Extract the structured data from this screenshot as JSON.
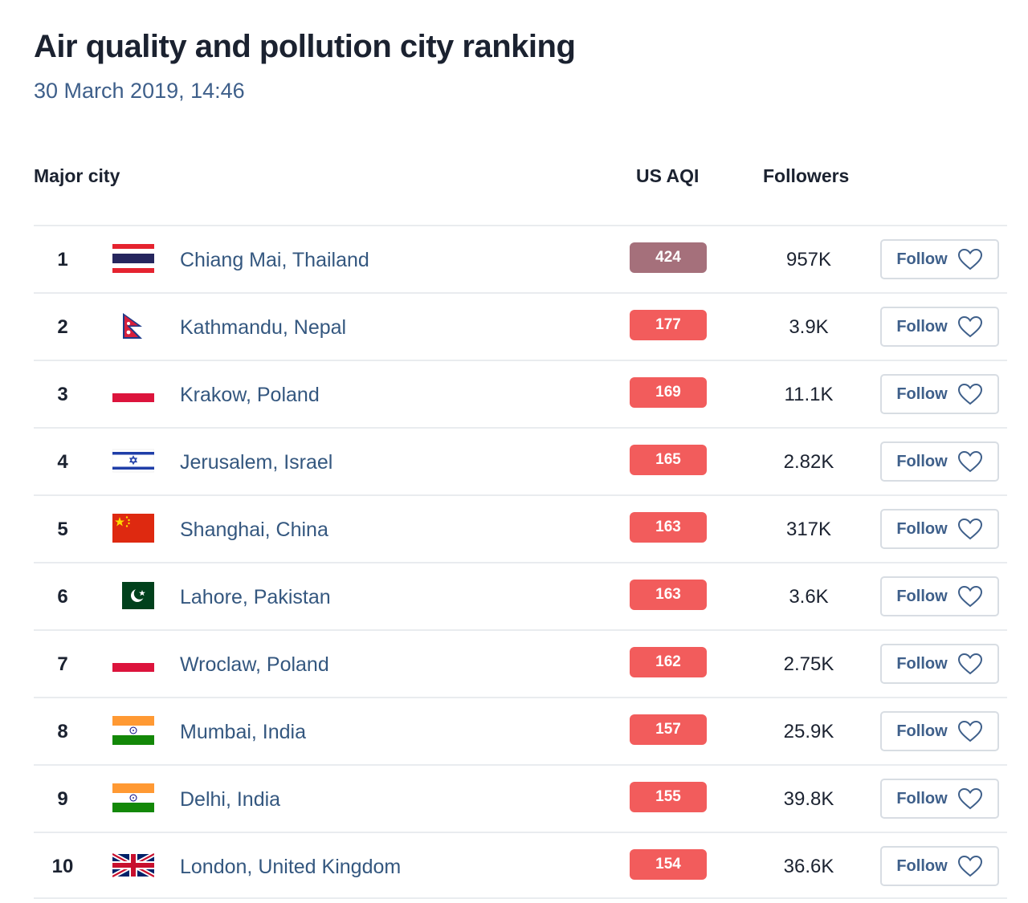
{
  "page": {
    "title": "Air quality and pollution city ranking",
    "timestamp": "30 March 2019, 14:46"
  },
  "columns": {
    "city": "Major city",
    "aqi": "US AQI",
    "followers": "Followers"
  },
  "colors": {
    "hazardous": "#a5707b",
    "unhealthy": "#f25c5c"
  },
  "rows": [
    {
      "rank": "1",
      "flag": "flag-thailand-icon",
      "city": "Chiang Mai, Thailand",
      "aqi": "424",
      "aqi_color": "#a5707b",
      "followers": "957K",
      "follow_label": "Follow"
    },
    {
      "rank": "2",
      "flag": "flag-nepal-icon",
      "city": "Kathmandu, Nepal",
      "aqi": "177",
      "aqi_color": "#f25c5c",
      "followers": "3.9K",
      "follow_label": "Follow"
    },
    {
      "rank": "3",
      "flag": "flag-poland-icon",
      "city": "Krakow, Poland",
      "aqi": "169",
      "aqi_color": "#f25c5c",
      "followers": "11.1K",
      "follow_label": "Follow"
    },
    {
      "rank": "4",
      "flag": "flag-israel-icon",
      "city": "Jerusalem, Israel",
      "aqi": "165",
      "aqi_color": "#f25c5c",
      "followers": "2.82K",
      "follow_label": "Follow"
    },
    {
      "rank": "5",
      "flag": "flag-china-icon",
      "city": "Shanghai, China",
      "aqi": "163",
      "aqi_color": "#f25c5c",
      "followers": "317K",
      "follow_label": "Follow"
    },
    {
      "rank": "6",
      "flag": "flag-pakistan-icon",
      "city": "Lahore, Pakistan",
      "aqi": "163",
      "aqi_color": "#f25c5c",
      "followers": "3.6K",
      "follow_label": "Follow"
    },
    {
      "rank": "7",
      "flag": "flag-poland-icon",
      "city": "Wroclaw, Poland",
      "aqi": "162",
      "aqi_color": "#f25c5c",
      "followers": "2.75K",
      "follow_label": "Follow"
    },
    {
      "rank": "8",
      "flag": "flag-india-icon",
      "city": "Mumbai, India",
      "aqi": "157",
      "aqi_color": "#f25c5c",
      "followers": "25.9K",
      "follow_label": "Follow"
    },
    {
      "rank": "9",
      "flag": "flag-india-icon",
      "city": "Delhi, India",
      "aqi": "155",
      "aqi_color": "#f25c5c",
      "followers": "39.8K",
      "follow_label": "Follow"
    },
    {
      "rank": "10",
      "flag": "flag-uk-icon",
      "city": "London, United Kingdom",
      "aqi": "154",
      "aqi_color": "#f25c5c",
      "followers": "36.6K",
      "follow_label": "Follow"
    }
  ]
}
